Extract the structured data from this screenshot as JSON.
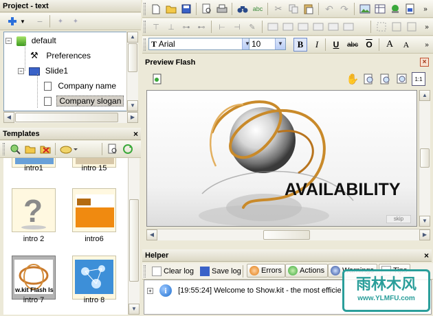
{
  "project_panel": {
    "title": "Project - text",
    "tree": [
      {
        "label": "default",
        "icon": "project-icon"
      },
      {
        "label": "Preferences",
        "icon": "tools-icon"
      },
      {
        "label": "Slide1",
        "icon": "slide-icon"
      },
      {
        "label": "Company name",
        "icon": "page-icon"
      },
      {
        "label": "Company slogan",
        "icon": "page-icon",
        "selected": true
      }
    ]
  },
  "templates_panel": {
    "title": "Templates",
    "close": "×",
    "items": [
      {
        "label": "intro1"
      },
      {
        "label": "intro 15"
      },
      {
        "label": "intro 2"
      },
      {
        "label": "intro6"
      },
      {
        "label": "intro 7",
        "selected": true,
        "caption": "w.kit Flash Is"
      },
      {
        "label": "intro 8"
      }
    ]
  },
  "format_bar": {
    "font": "Arial",
    "size": "10",
    "bold": "B",
    "italic": "I",
    "underline": "U",
    "strike": "abc",
    "overline": "O",
    "grow": "A",
    "shrink": "A"
  },
  "preview_panel": {
    "title": "Preview Flash",
    "headline": "AVAILABILITY",
    "skip": "skip"
  },
  "helper_panel": {
    "title": "Helper",
    "buttons": {
      "clear_log": "Clear log",
      "save_log": "Save log",
      "errors": "Errors",
      "actions": "Actions",
      "warnings": "Warnings",
      "tips": "Tips"
    },
    "log_entry": "[19:55:24] Welcome to Show.kit - the most efficie"
  },
  "watermark": {
    "text": "雨林木风",
    "url": "www.YLMFU.com"
  },
  "colors": {
    "panel_bg": "#ece9d8",
    "accent_orange": "#e07a10",
    "info_blue": "#1f6fd0"
  }
}
